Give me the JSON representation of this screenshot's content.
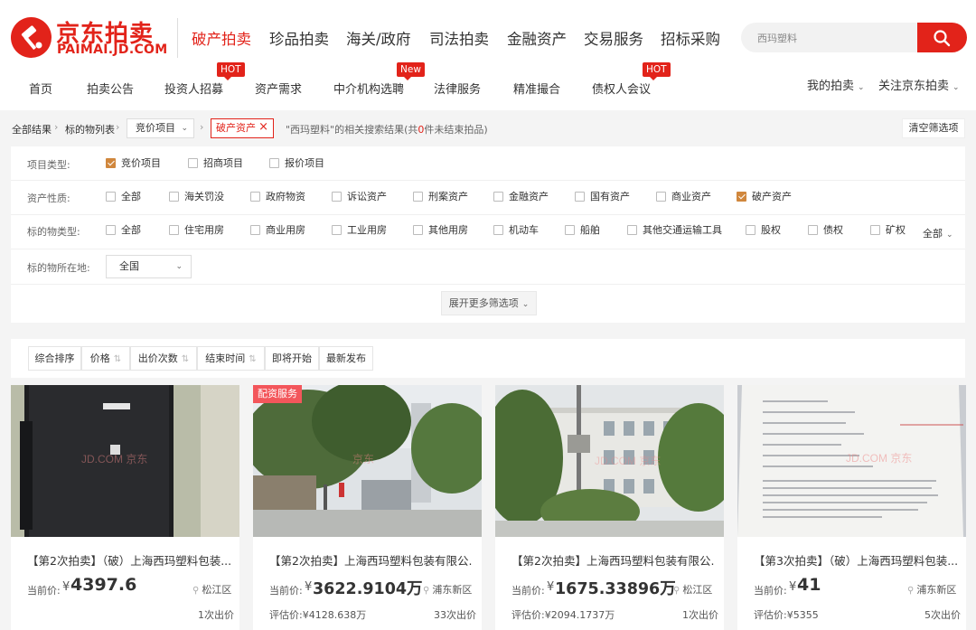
{
  "header": {
    "logo_cn": "京东拍卖",
    "logo_en": "PAIMAI.JD.COM",
    "main_nav": [
      "破产拍卖",
      "珍品拍卖",
      "海关/政府",
      "司法拍卖",
      "金融资产",
      "交易服务",
      "招标采购"
    ],
    "sub_nav": [
      "首页",
      "拍卖公告",
      "投资人招募",
      "资产需求",
      "中介机构选聘",
      "法律服务",
      "精准撮合",
      "债权人会议"
    ],
    "badges": {
      "hot": "HOT",
      "new": "New"
    },
    "search": {
      "value": "西玛塑料"
    },
    "my_auction": "我的拍卖",
    "follow": "关注京东拍卖"
  },
  "breadcrumb": {
    "all": "全部结果",
    "list": "标的物列表",
    "select": "竞价项目",
    "tag": "破产资产",
    "result_prefix": "\"西玛塑料\"的相关搜索结果(共",
    "result_count": "0",
    "result_suffix": "件未结束拍品)",
    "clear": "清空筛选项"
  },
  "filters": {
    "project_type": {
      "label": "项目类型:",
      "options": [
        {
          "text": "竞价项目",
          "checked": true
        },
        {
          "text": "招商项目",
          "checked": false
        },
        {
          "text": "报价项目",
          "checked": false
        }
      ]
    },
    "asset_nature": {
      "label": "资产性质:",
      "options": [
        {
          "text": "全部",
          "checked": false
        },
        {
          "text": "海关罚没",
          "checked": false
        },
        {
          "text": "政府物资",
          "checked": false
        },
        {
          "text": "诉讼资产",
          "checked": false
        },
        {
          "text": "刑案资产",
          "checked": false
        },
        {
          "text": "金融资产",
          "checked": false
        },
        {
          "text": "国有资产",
          "checked": false
        },
        {
          "text": "商业资产",
          "checked": false
        },
        {
          "text": "破产资产",
          "checked": true
        }
      ]
    },
    "item_type": {
      "label": "标的物类型:",
      "options": [
        {
          "text": "全部",
          "checked": false
        },
        {
          "text": "住宅用房",
          "checked": false
        },
        {
          "text": "商业用房",
          "checked": false
        },
        {
          "text": "工业用房",
          "checked": false
        },
        {
          "text": "其他用房",
          "checked": false
        },
        {
          "text": "机动车",
          "checked": false
        },
        {
          "text": "船舶",
          "checked": false
        },
        {
          "text": "其他交通运输工具",
          "checked": false
        },
        {
          "text": "股权",
          "checked": false
        },
        {
          "text": "债权",
          "checked": false
        },
        {
          "text": "矿权",
          "checked": false
        }
      ],
      "more": "全部"
    },
    "location": {
      "label": "标的物所在地:",
      "value": "全国"
    },
    "expand": "展开更多筛选项"
  },
  "sort": [
    {
      "label": "综合排序",
      "arrow": false
    },
    {
      "label": "价格",
      "arrow": true
    },
    {
      "label": "出价次数",
      "arrow": true
    },
    {
      "label": "结束时间",
      "arrow": true
    },
    {
      "label": "即将开始",
      "arrow": false
    },
    {
      "label": "最新发布",
      "arrow": false
    }
  ],
  "cards": [
    {
      "title": "【第2次拍卖】（破）上海西玛塑料包装...",
      "price_label": "当前价:",
      "currency": "¥",
      "price": "4397.6",
      "location": "松江区",
      "estimate": "",
      "bids": "1次出价",
      "ribbon": ""
    },
    {
      "title": "【第2次拍卖】上海西玛塑料包装有限公...",
      "price_label": "当前价:",
      "currency": "¥",
      "price": "3622.9104万",
      "location": "浦东新区",
      "estimate": "评估价:¥4128.638万",
      "bids": "33次出价",
      "ribbon": "配资服务"
    },
    {
      "title": "【第2次拍卖】上海西玛塑料包装有限公...",
      "price_label": "当前价:",
      "currency": "¥",
      "price": "1675.33896万",
      "location": "松江区",
      "estimate": "评估价:¥2094.1737万",
      "bids": "1次出价",
      "ribbon": ""
    },
    {
      "title": "【第3次拍卖】（破）上海西玛塑料包装...",
      "price_label": "当前价:",
      "currency": "¥",
      "price": "41",
      "location": "浦东新区",
      "estimate": "评估价:¥5355",
      "bids": "5次出价",
      "ribbon": ""
    }
  ],
  "colors": {
    "brand": "#e2231a",
    "check": "#d0873d",
    "ribbon": "#f3565b"
  }
}
